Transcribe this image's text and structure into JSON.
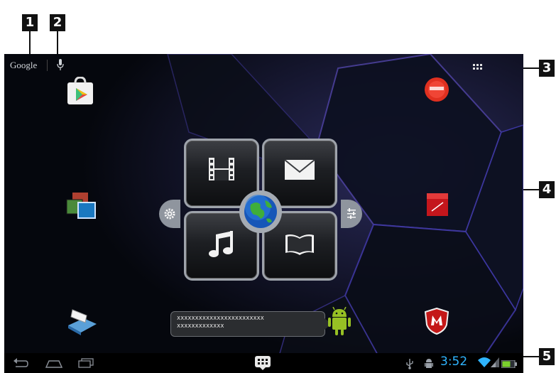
{
  "callouts": [
    "1",
    "2",
    "3",
    "4",
    "5"
  ],
  "topbar": {
    "search_label": "Google",
    "voice_icon": "microphone-icon",
    "apps_icon": "apps-grid-icon"
  },
  "home_icons": {
    "left": [
      "play-store-icon",
      "gallery-icon",
      "scanner-icon"
    ],
    "right": [
      "lenovo-shop-icon",
      "notes-icon",
      "mcafee-icon"
    ]
  },
  "widget": {
    "tiles": [
      "video-icon",
      "mail-icon",
      "music-icon",
      "book-icon"
    ],
    "center": "globe-icon",
    "side_left": "gear-icon",
    "side_right": "equalizer-icon"
  },
  "bubble": {
    "line1": "xxxxxxxxxxxxxxxxxxxxxxxx",
    "line2": "xxxxxxxxxxxxx"
  },
  "mascot": "android-icon",
  "navbar": {
    "buttons": [
      "back-icon",
      "home-icon",
      "recent-apps-icon"
    ],
    "center": "app-drawer-icon",
    "status_icons": [
      "usb-icon",
      "android-debug-icon",
      "wifi-icon",
      "signal-icon",
      "battery-icon"
    ],
    "clock": "3:52"
  },
  "colors": {
    "clock": "#2fb4ff",
    "wallpaper": "#070a12",
    "android": "#97c024"
  }
}
